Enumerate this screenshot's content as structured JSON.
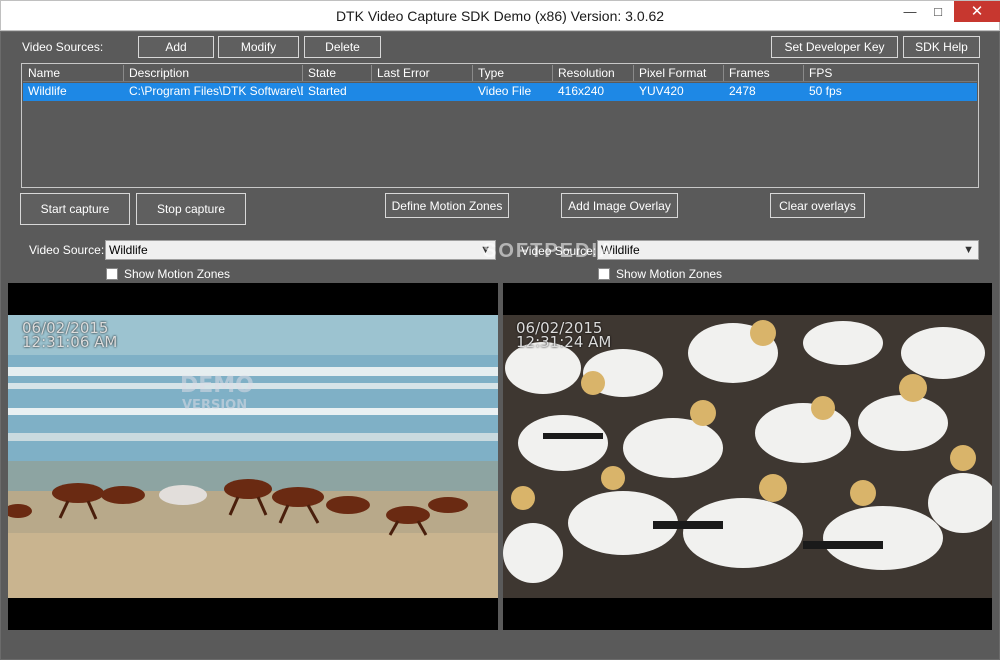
{
  "window": {
    "title": "DTK Video Capture SDK Demo (x86) Version: 3.0.62",
    "minimize_glyph": "—",
    "maximize_glyph": "□",
    "close_glyph": "✕"
  },
  "sources": {
    "label": "Video Sources:",
    "add_label": "Add",
    "modify_label": "Modify",
    "delete_label": "Delete",
    "set_key_label": "Set Developer Key",
    "help_label": "SDK Help"
  },
  "table": {
    "columns": [
      "Name",
      "Description",
      "State",
      "Last Error",
      "Type",
      "Resolution",
      "Pixel Format",
      "Frames",
      "FPS"
    ],
    "rows": [
      [
        "Wildlife",
        "C:\\Program Files\\DTK Software\\D...",
        "Started",
        "",
        "Video File",
        "416x240",
        "YUV420",
        "2478",
        "50 fps"
      ]
    ],
    "selected_color": "#1e88e5"
  },
  "actions": {
    "start_label": "Start capture",
    "stop_label": "Stop capture",
    "motion_label": "Define Motion Zones",
    "overlay_label": "Add Image Overlay",
    "clear_label": "Clear overlays"
  },
  "left": {
    "source_label": "Video Source:",
    "source_value": "Wildlife",
    "motion_label": "Show Motion Zones",
    "date": "06/02/2015",
    "time": "12:31:06 AM",
    "wm1": "DEMO",
    "wm2": "VERSION"
  },
  "right": {
    "source_label": "Video Source:",
    "source_value": "Wildlife",
    "motion_label": "Show Motion Zones",
    "date": "06/02/2015",
    "time": "12:31:24 AM"
  },
  "watermark": "SOFTPEDIA",
  "icons": {
    "dropdown": "chevron-down-icon",
    "checkbox": "checkbox-icon"
  },
  "colors": {
    "background": "#5a5a5a",
    "selection": "#1e88e5",
    "close_button": "#c7372f"
  }
}
